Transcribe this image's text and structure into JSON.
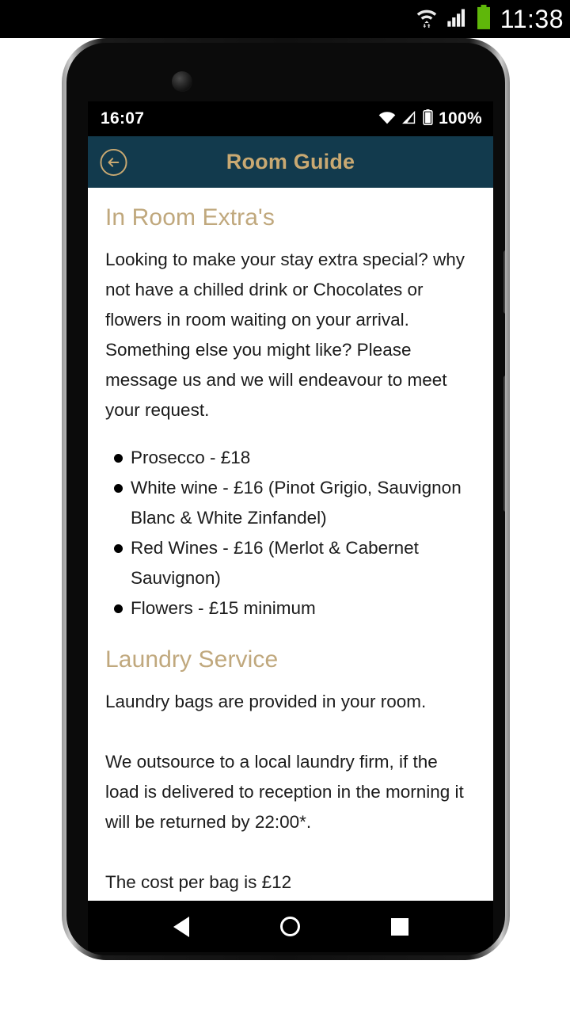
{
  "os_status_bar": {
    "time": "11:38",
    "icons": [
      "wifi-data-icon",
      "cellular-signal-icon",
      "battery-full-icon"
    ]
  },
  "phone": {
    "app_status_bar": {
      "time": "16:07",
      "battery_percent": "100%",
      "icons": [
        "wifi-icon",
        "signal-icon",
        "battery-icon"
      ]
    },
    "header": {
      "title": "Room Guide",
      "back_icon": "circle-back-arrow-icon",
      "background_color": "#123a4d",
      "title_color": "#c9a972"
    },
    "content": {
      "sections": [
        {
          "heading": "In Room Extra's",
          "paragraphs": [
            "Looking to make your stay extra special? why not have a chilled drink or Chocolates or flowers in room waiting on your arrival. Something else you might like? Please message us and we will endeavour to meet your request."
          ],
          "list": [
            "Prosecco - £18",
            "White wine - £16 (Pinot Grigio, Sauvignon Blanc & White Zinfandel)",
            "Red Wines - £16 (Merlot & Cabernet Sauvignon)",
            "Flowers - £15 minimum"
          ]
        },
        {
          "heading": "Laundry Service",
          "paragraphs": [
            "Laundry bags are provided in your room.",
            "We outsource to a local laundry firm, if the load is delivered to reception in the morning it will be returned by 22:00*.",
            "The cost per bag is £12"
          ]
        }
      ],
      "heading_color": "#c0a87d",
      "text_color": "#1c1c1c"
    },
    "navbar": {
      "back": "nav-back-icon",
      "home": "nav-home-icon",
      "recents": "nav-recents-icon"
    }
  }
}
